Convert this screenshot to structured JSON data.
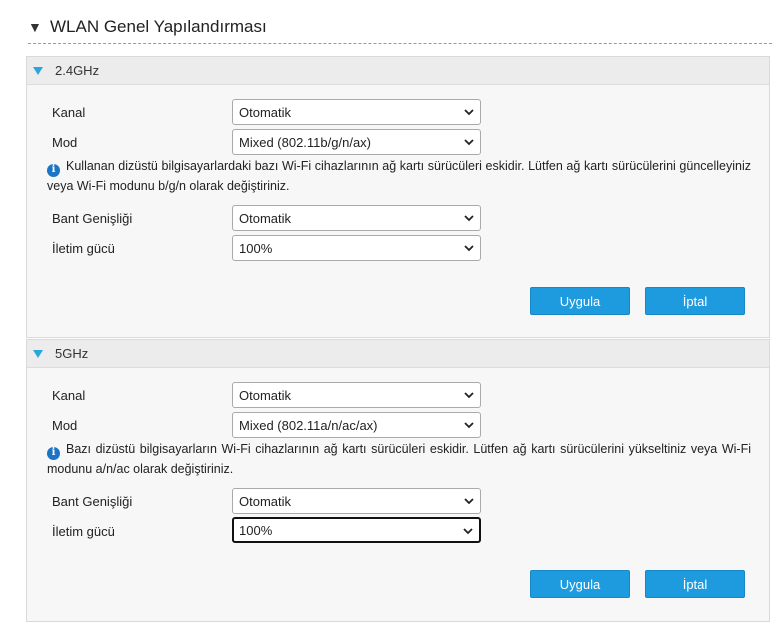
{
  "page": {
    "title": "WLAN Genel Yapılandırması",
    "collapse_icon": "triangle-down"
  },
  "colors": {
    "accent": "#1e9bdf",
    "info": "#1b74c5",
    "header_triangle": "#2aa6dd"
  },
  "band24": {
    "header": "2.4GHz",
    "channel_label": "Kanal",
    "channel_value": "Otomatik",
    "mode_label": "Mod",
    "mode_value": "Mixed (802.11b/g/n/ax)",
    "note": "Kullanan dizüstü bilgisayarlardaki bazı Wi-Fi cihazlarının ağ kartı sürücüleri eskidir. Lütfen ağ kartı sürücülerini güncelleyiniz veya Wi-Fi modunu b/g/n olarak değiştiriniz.",
    "bandwidth_label": "Bant Genişliği",
    "bandwidth_value": "Otomatik",
    "power_label": "İletim gücü",
    "power_value": "100%",
    "apply_label": "Uygula",
    "cancel_label": "İptal"
  },
  "band5": {
    "header": "5GHz",
    "channel_label": "Kanal",
    "channel_value": "Otomatik",
    "mode_label": "Mod",
    "mode_value": "Mixed (802.11a/n/ac/ax)",
    "note": "Bazı dizüstü bilgisayarların Wi-Fi cihazlarının ağ kartı sürücüleri eskidir. Lütfen ağ kartı sürücülerini yükseltiniz veya Wi-Fi modunu a/n/ac olarak değiştiriniz.",
    "bandwidth_label": "Bant Genişliği",
    "bandwidth_value": "Otomatik",
    "power_label": "İletim gücü",
    "power_value": "100%",
    "apply_label": "Uygula",
    "cancel_label": "İptal"
  }
}
